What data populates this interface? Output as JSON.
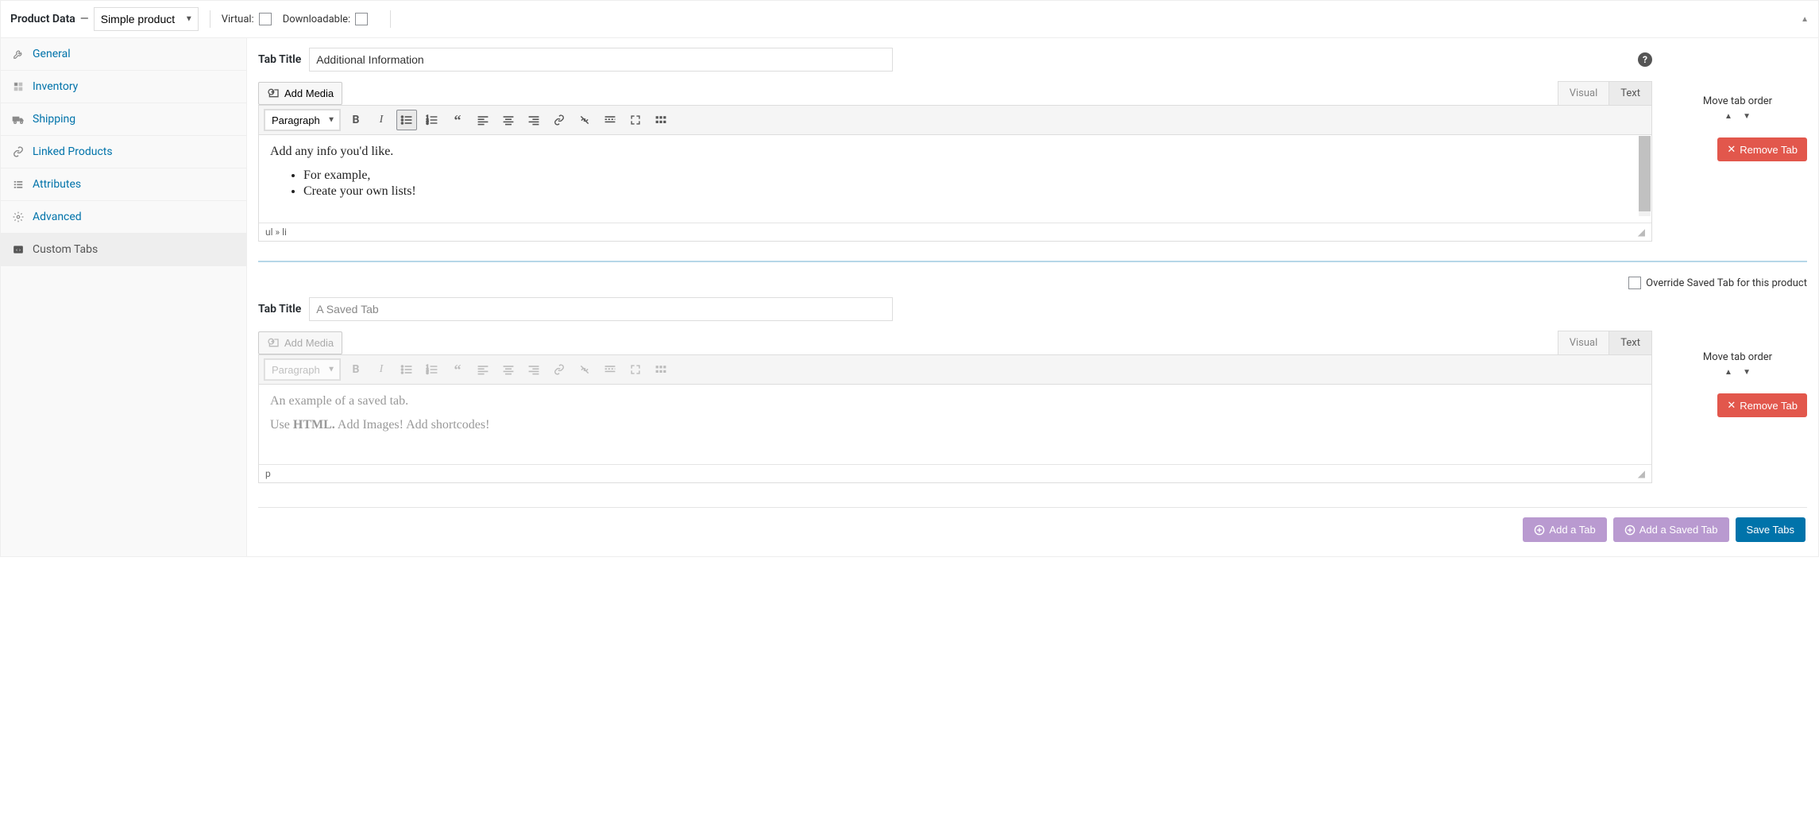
{
  "header": {
    "title": "Product Data",
    "dash": "—",
    "product_type": "Simple product",
    "virtual_label": "Virtual:",
    "downloadable_label": "Downloadable:"
  },
  "sidebar": {
    "items": [
      {
        "label": "General"
      },
      {
        "label": "Inventory"
      },
      {
        "label": "Shipping"
      },
      {
        "label": "Linked Products"
      },
      {
        "label": "Attributes"
      },
      {
        "label": "Advanced"
      },
      {
        "label": "Custom Tabs"
      }
    ]
  },
  "editor1": {
    "tab_title_label": "Tab Title",
    "tab_title_value": "Additional Information",
    "add_media": "Add Media",
    "para": "Paragraph",
    "tabs": {
      "visual": "Visual",
      "text": "Text"
    },
    "content": {
      "p1": "Add any info you'd like.",
      "li1": "For example,",
      "li2": "Create your own lists!"
    },
    "path": "ul » li"
  },
  "editor2": {
    "tab_title_label": "Tab Title",
    "tab_title_value": "A Saved Tab",
    "override_label": "Override Saved Tab for this product",
    "add_media": "Add Media",
    "para": "Paragraph",
    "tabs": {
      "visual": "Visual",
      "text": "Text"
    },
    "content": {
      "p1_a": "An example of a saved tab.",
      "p2_a": "Use ",
      "p2_b": "HTML.",
      "p2_c": " Add Images! Add shortcodes!"
    },
    "path": "p"
  },
  "side": {
    "move_label": "Move tab order",
    "remove_label": "Remove Tab"
  },
  "footer": {
    "add_tab": "Add a Tab",
    "add_saved_tab": "Add a Saved Tab",
    "save_tabs": "Save Tabs"
  }
}
